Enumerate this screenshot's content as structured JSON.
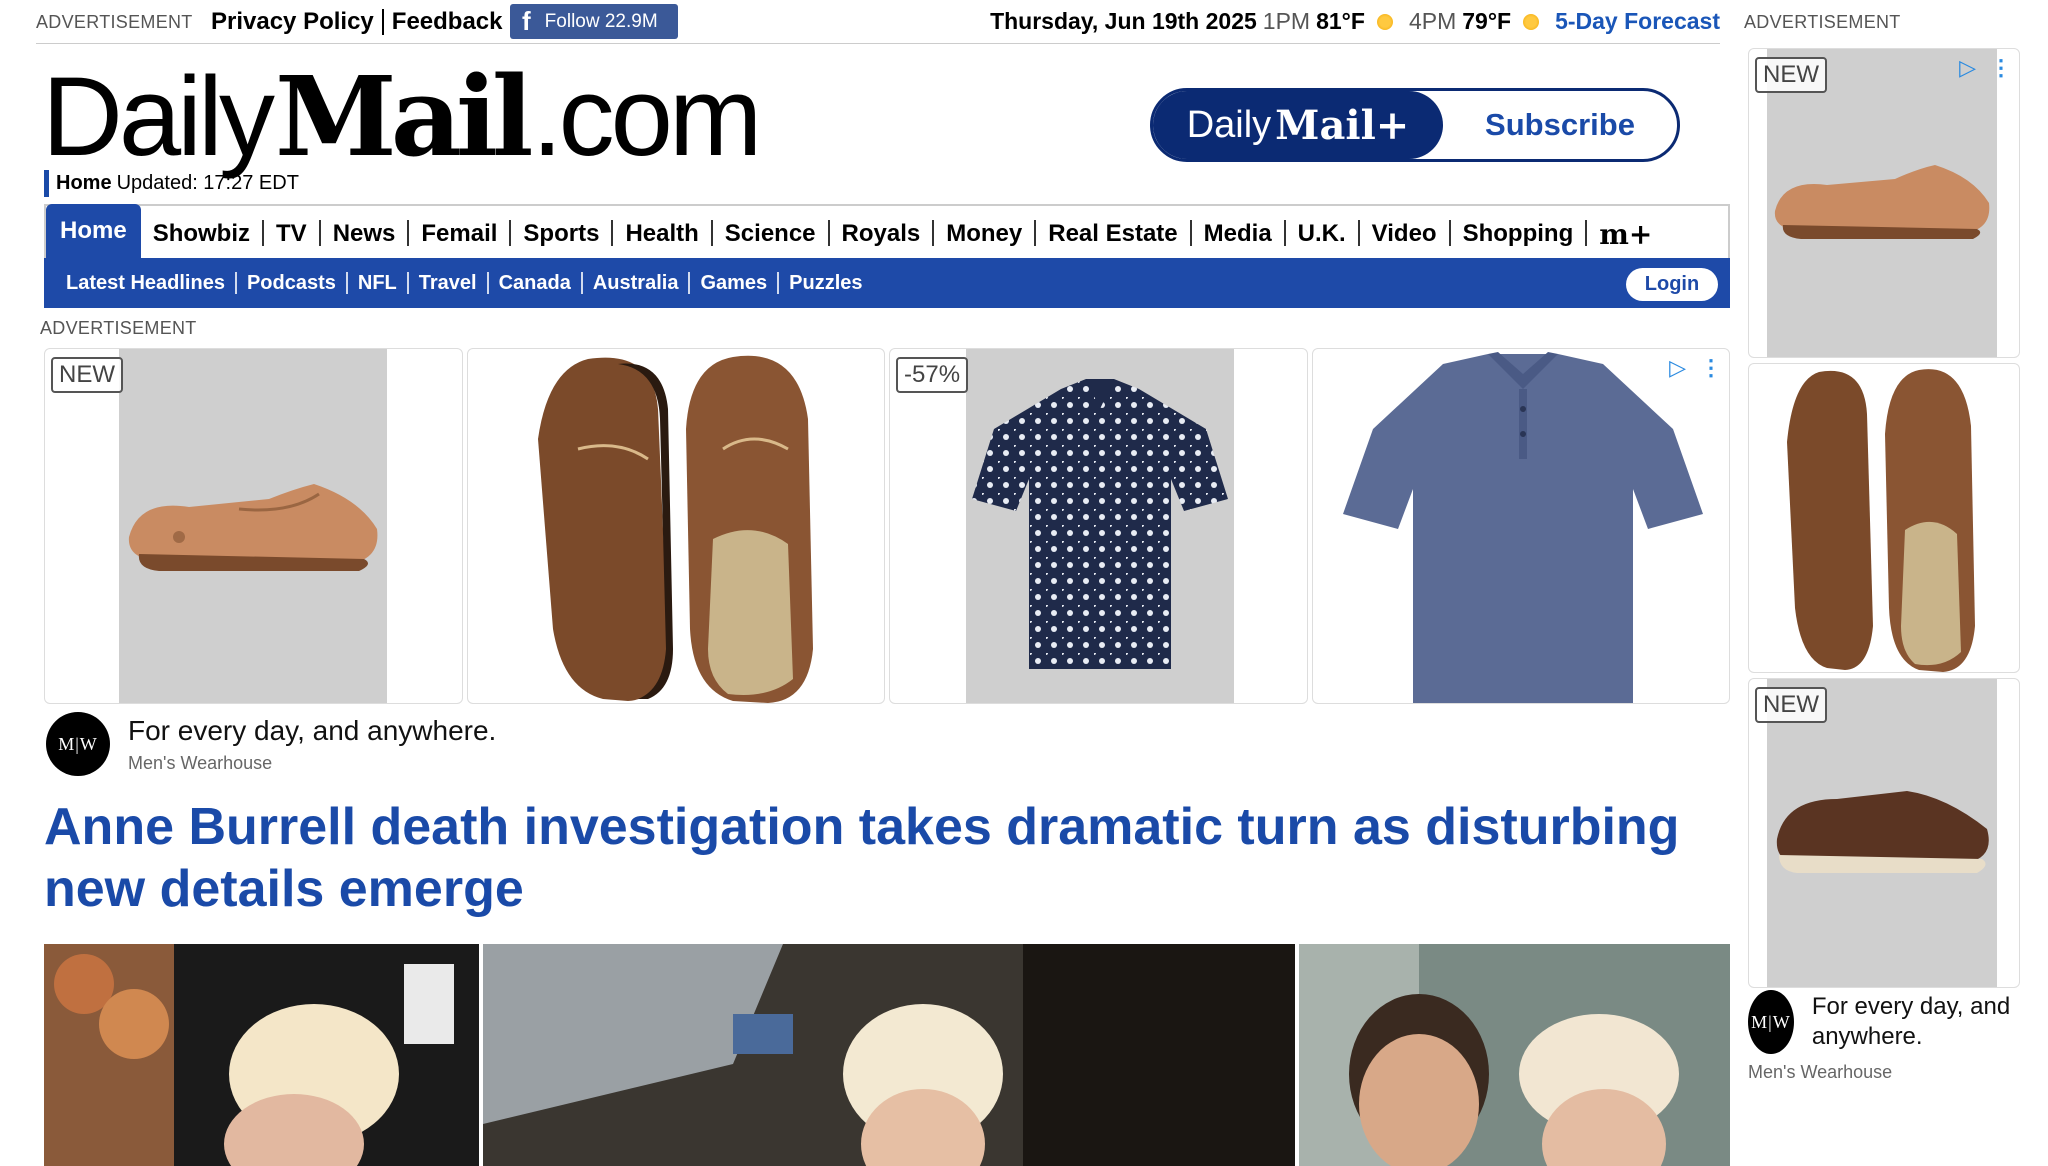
{
  "topbar": {
    "ad_label": "ADVERTISEMENT",
    "privacy": "Privacy Policy",
    "feedback": "Feedback",
    "fb_follow": "Follow 22.9M",
    "date": "Thursday, Jun 19th 2025",
    "time1": "1PM",
    "temp1": "81°F",
    "time2": "4PM",
    "temp2": "79°F",
    "forecast": "5-Day Forecast"
  },
  "masthead": {
    "logo_daily": "Daily",
    "logo_mail": "Mail",
    "logo_com": ".com",
    "section": "Home",
    "updated": "Updated: 17:27 EDT",
    "sub_brand_daily": "Daily",
    "sub_brand_mail": "Mail+",
    "subscribe": "Subscribe"
  },
  "nav_primary": [
    {
      "label": "Home",
      "active": true
    },
    {
      "label": "Showbiz"
    },
    {
      "label": "TV"
    },
    {
      "label": "News"
    },
    {
      "label": "Femail"
    },
    {
      "label": "Sports"
    },
    {
      "label": "Health"
    },
    {
      "label": "Science"
    },
    {
      "label": "Royals"
    },
    {
      "label": "Money"
    },
    {
      "label": "Real Estate"
    },
    {
      "label": "Media"
    },
    {
      "label": "U.K."
    },
    {
      "label": "Video"
    },
    {
      "label": "Shopping"
    },
    {
      "label": "m+"
    }
  ],
  "nav_secondary": [
    "Latest Headlines",
    "Podcasts",
    "NFL",
    "Travel",
    "Canada",
    "Australia",
    "Games",
    "Puzzles"
  ],
  "login": "Login",
  "ad_strip": {
    "label": "ADVERTISEMENT",
    "badge_new": "NEW",
    "badge_discount": "-57%",
    "tagline": "For every day, and anywhere.",
    "advertiser": "Men's Wearhouse",
    "advertiser_logo": "M|W"
  },
  "headline": "Anne Burrell death investigation takes dramatic turn as disturbing new details emerge",
  "rail": {
    "ad_label": "ADVERTISEMENT",
    "badge_new": "NEW",
    "tagline": "For every day, and anywhere.",
    "advertiser": "Men's Wearhouse",
    "advertiser_logo": "M|W"
  },
  "colors": {
    "brand_blue": "#1e4aa8",
    "navy": "#0b2a73",
    "facebook": "#3b5998",
    "link_blue": "#1a56b8"
  }
}
